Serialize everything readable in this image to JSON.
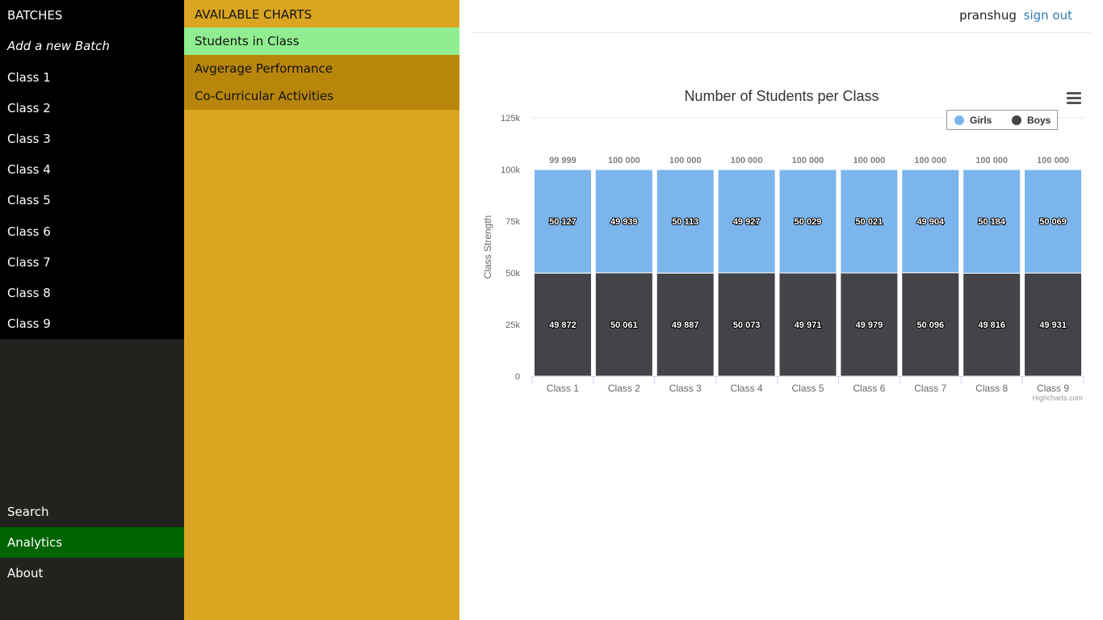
{
  "sidebar": {
    "header": "BATCHES",
    "add_batch": "Add a new Batch",
    "classes": [
      "Class 1",
      "Class 2",
      "Class 3",
      "Class 4",
      "Class 5",
      "Class 6",
      "Class 7",
      "Class 8",
      "Class 9"
    ],
    "bottom": [
      "Search",
      "Analytics",
      "About"
    ],
    "active": "Analytics"
  },
  "chart_menu": {
    "header": "AVAILABLE CHARTS",
    "items": [
      "Students in Class",
      "Avgerage Performance",
      "Co-Curricular Activities"
    ],
    "active": "Students in Class"
  },
  "topbar": {
    "username": "pranshug",
    "signout": "sign out"
  },
  "chart_data": {
    "type": "bar",
    "stacked": true,
    "title": "Number of Students per Class",
    "ylabel": "Class Strength",
    "ylim": [
      0,
      125000
    ],
    "yticks": [
      "0",
      "25k",
      "50k",
      "75k",
      "100k",
      "125k"
    ],
    "categories": [
      "Class 1",
      "Class 2",
      "Class 3",
      "Class 4",
      "Class 5",
      "Class 6",
      "Class 7",
      "Class 8",
      "Class 9"
    ],
    "series": [
      {
        "name": "Girls",
        "color": "#7cb5ec",
        "values": [
          50127,
          49939,
          50113,
          49927,
          50029,
          50021,
          49904,
          50184,
          50069
        ],
        "labels": [
          "50 127",
          "49 939",
          "50 113",
          "49 927",
          "50 029",
          "50 021",
          "49 904",
          "50 184",
          "50 069"
        ]
      },
      {
        "name": "Boys",
        "color": "#434348",
        "values": [
          49872,
          50061,
          49887,
          50073,
          49971,
          49979,
          50096,
          49816,
          49931
        ],
        "labels": [
          "49 872",
          "50 061",
          "49 887",
          "50 073",
          "49 971",
          "49 979",
          "50 096",
          "49 816",
          "49 931"
        ]
      }
    ],
    "totals": [
      "99 999",
      "100 000",
      "100 000",
      "100 000",
      "100 000",
      "100 000",
      "100 000",
      "100 000",
      "100 000"
    ],
    "legend_position": "top-right",
    "credits": "Highcharts.com"
  }
}
